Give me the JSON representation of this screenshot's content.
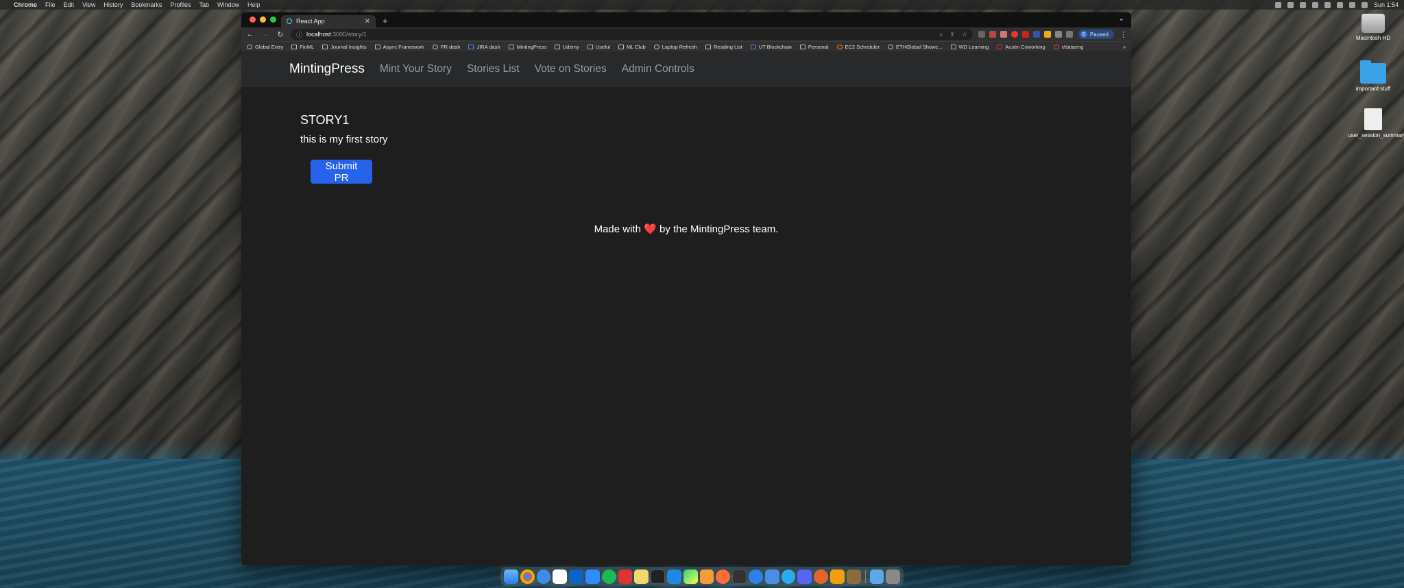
{
  "menubar": {
    "app_name": "Chrome",
    "menus": [
      "File",
      "Edit",
      "View",
      "History",
      "Bookmarks",
      "Profiles",
      "Tab",
      "Window",
      "Help"
    ],
    "clock": "Sun 1:54"
  },
  "desktop": {
    "icons": [
      {
        "label": "Macintosh HD"
      },
      {
        "label": "important stuff"
      },
      {
        "label": "user_session_summary.conf.mako"
      }
    ]
  },
  "browser": {
    "tab_title": "React App",
    "url_host": "localhost",
    "url_path": ":3000/story/1",
    "profile_status": "Paused",
    "profile_initial": "S",
    "bookmarks": [
      "Global Entry",
      "FinML",
      "Journal Insights",
      "Async Framework",
      "PR dash",
      "JIRA dash",
      "MintingPress",
      "Udemy",
      "Useful",
      "ML Club",
      "Laptop Refresh",
      "Reading List",
      "UT Blockchain",
      "Personal",
      "EC2 Scheduler",
      "ETHGlobal Showc...",
      "WD Learning",
      "Austin Coworking",
      "r/dataeng"
    ]
  },
  "app": {
    "brand": "MintingPress",
    "nav": [
      "Mint Your Story",
      "Stories List",
      "Vote on Stories",
      "Admin Controls"
    ],
    "story": {
      "title": "STORY1",
      "body": "this is my first story"
    },
    "submit_label": "Submit PR",
    "footer": {
      "before": "Made with",
      "heart": "❤️",
      "after": "by the MintingPress team."
    }
  },
  "colors": {
    "primary_button": "#2563eb",
    "navbar_bg": "#27292b",
    "page_bg": "#1e1e1e"
  },
  "dock": {
    "apps": [
      "finder-icon",
      "chrome-icon",
      "safari-icon",
      "slack-icon",
      "outlook-icon",
      "zoom-icon",
      "spotify-icon",
      "photo-booth-icon",
      "notes-icon",
      "terminal-icon",
      "vscode-icon",
      "pycharm-icon",
      "sublime-icon",
      "postman-icon",
      "terminal-2-icon",
      "messenger-icon",
      "mail-icon",
      "telegram-icon",
      "discord-icon",
      "cloud-icon",
      "fireship-icon",
      "archive-icon",
      "folder-icon",
      "trash-icon"
    ]
  }
}
